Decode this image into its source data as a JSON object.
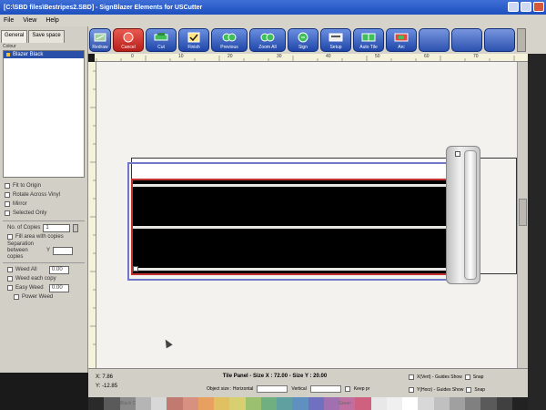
{
  "window": {
    "title": "[C:\\SBD files\\Bestripes2.SBD] - SignBlazer Elements for USCutter"
  },
  "menu": [
    "File",
    "View",
    "Help"
  ],
  "left_panel": {
    "tabs": [
      "General",
      "Save space"
    ],
    "layer_header": "Colour",
    "layers": [
      "Blazer Black"
    ],
    "options": [
      "Fit to Origin",
      "Rotate Across Vinyl",
      "Mirror",
      "Selected Only"
    ],
    "copies_label": "No. of Copies",
    "copies_value": "1",
    "fill_area_label": "Fill area with copies",
    "separation_label": "Separation between copies",
    "separation_y_label": "Y",
    "weed_all_label": "Weed All",
    "weed_all_value": "0.00",
    "weed_each_label": "Weed each copy",
    "easy_weed_label": "Easy Weed",
    "easy_weed_value": "0.00",
    "power_weed_label": "Power Weed"
  },
  "toolbar": {
    "buttons": [
      "Redraw",
      "Cancel",
      "Cut",
      "Finish",
      "Previous",
      "Zoom All",
      "Sign",
      "Setup",
      "Auto Tile",
      "Arc"
    ]
  },
  "rulers": {
    "h_ticks": [
      "0",
      "10",
      "20",
      "30",
      "40",
      "50",
      "60",
      "70"
    ]
  },
  "status": {
    "x_label": "X:",
    "x_value": "7.86",
    "y_label": "Y:",
    "y_value": "-12.85",
    "tile_panel": "Tile Panel - Size X : 72.00 - Size Y : 20.00",
    "object_size_label": "Object size : Horizontal",
    "vertical_label": "Vertical",
    "keep_prop_label": "Keep pr",
    "guides_x": "X(Vert) - Guides Show",
    "guides_y": "Y(Horz) - Guides Show",
    "snap_label": "Snap"
  },
  "palette": {
    "colors": [
      "#2a2a2a",
      "#5a5a5a",
      "#8a8a8a",
      "#b5b5b5",
      "#d8d8d8",
      "#c07a70",
      "#d89080",
      "#e8a060",
      "#e0c060",
      "#d8d070",
      "#9ac070",
      "#70b080",
      "#60a0a0",
      "#6090c0",
      "#7070c0",
      "#a070b0",
      "#c070a0",
      "#d06080",
      "#e8e8e8",
      "#f0f0f0",
      "#ffffff",
      "#d8d8d8",
      "#c0c0c0",
      "#a0a0a0",
      "#808080",
      "#5a5a5a",
      "#404040",
      "#222222"
    ],
    "label_left": "Black C",
    "label_right": "Green"
  }
}
